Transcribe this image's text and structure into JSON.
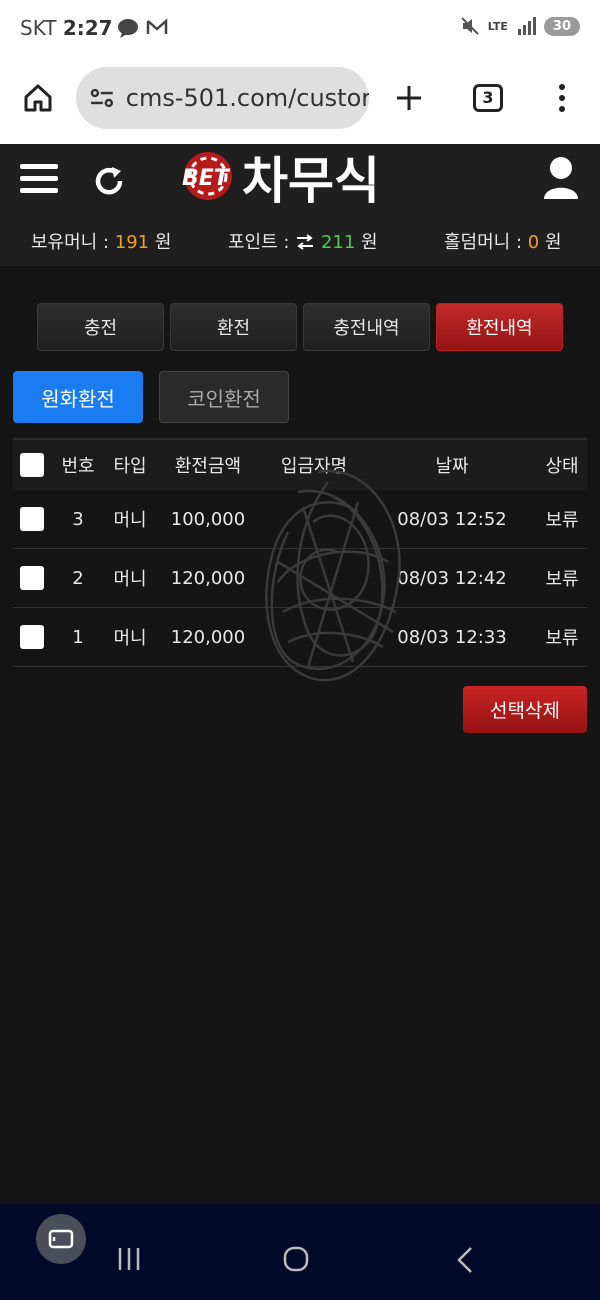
{
  "status": {
    "carrier": "SKT",
    "time": "2:27",
    "network": "LTE",
    "battery": "30"
  },
  "browser": {
    "url": "cms-501.com/custor",
    "tab_count": "3"
  },
  "header": {
    "logo_prefix": "BET",
    "logo_text": "차무식"
  },
  "balances": {
    "money_label": "보유머니 :",
    "money_value": "191",
    "money_unit": "원",
    "point_label": "포인트 :",
    "point_value": "211",
    "point_unit": "원",
    "holdem_label": "홀덤머니 :",
    "holdem_value": "0",
    "holdem_unit": "원"
  },
  "tabs": [
    {
      "label": "충전",
      "active": false
    },
    {
      "label": "환전",
      "active": false
    },
    {
      "label": "충전내역",
      "active": false
    },
    {
      "label": "환전내역",
      "active": true
    }
  ],
  "subtabs": [
    {
      "label": "원화환전",
      "active": true
    },
    {
      "label": "코인환전",
      "active": false
    }
  ],
  "table": {
    "headers": [
      "번호",
      "타입",
      "환전금액",
      "입금자명",
      "날짜",
      "상태"
    ],
    "rows": [
      {
        "no": "3",
        "type": "머니",
        "amount": "100,000",
        "date": "08/03 12:52",
        "status": "보류"
      },
      {
        "no": "2",
        "type": "머니",
        "amount": "120,000",
        "date": "08/03 12:42",
        "status": "보류"
      },
      {
        "no": "1",
        "type": "머니",
        "amount": "120,000",
        "date": "08/03 12:33",
        "status": "보류"
      }
    ]
  },
  "actions": {
    "delete_label": "선택삭제"
  },
  "colors": {
    "accent_red": "#b81c1c",
    "accent_blue": "#1b7cf2",
    "money_orange": "#f0a020",
    "point_green": "#4ccc4c"
  }
}
